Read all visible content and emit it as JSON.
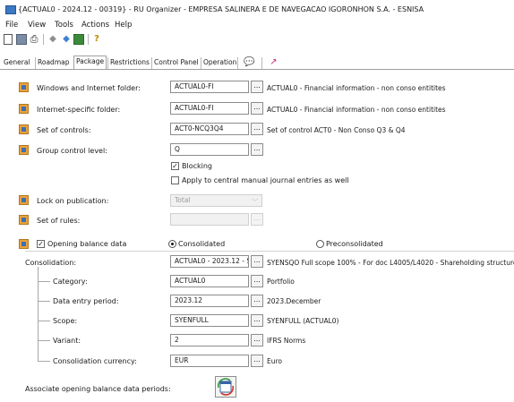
{
  "window": {
    "title": "{ACTUAL0 - 2024.12 - 00319} - RU Organizer - EMPRESA SALINERA E DE NAVEGACAO IGORONHON S.A. - ESNISA"
  },
  "menu": [
    "File",
    "View",
    "Tools",
    "Actions",
    "Help"
  ],
  "toolbar": {
    "icons": [
      "new-document-icon",
      "save-icon",
      "print-icon",
      "back-arrow-icon",
      "forward-arrow-icon",
      "refresh-icon",
      "help-icon"
    ]
  },
  "tabs": [
    "General",
    "Roadmap",
    "Package",
    "Restrictions",
    "Control Panel",
    "Operation"
  ],
  "active_tab": "Package",
  "fields": {
    "windows_folder": {
      "label": "Windows and Internet folder:",
      "value": "ACTUAL0-FI",
      "desc": "ACTUAL0 - Financial information - non conso entitites"
    },
    "internet_folder": {
      "label": "Internet-specific folder:",
      "value": "ACTUAL0-FI",
      "desc": "ACTUAL0 - Financial information - non conso entitites"
    },
    "set_of_controls": {
      "label": "Set of controls:",
      "value": "ACT0-NCQ3Q4",
      "desc": "Set of control ACT0 - Non Conso Q3 & Q4"
    },
    "group_control_level": {
      "label": "Group control level:",
      "value": "Q"
    },
    "blocking": {
      "label": "Blocking",
      "checked": true
    },
    "apply_manual": {
      "label": "Apply to central manual journal entries as well",
      "checked": false
    },
    "lock_on_publication": {
      "label": "Lock on publication:",
      "value": "Total"
    },
    "set_of_rules": {
      "label": "Set of rules:",
      "value": ""
    },
    "opening_balance": {
      "label": "Opening balance data",
      "checked": true
    },
    "radio_consolidated": {
      "label": "Consolidated",
      "selected": true
    },
    "radio_preconsolidated": {
      "label": "Preconsolidated",
      "selected": false
    },
    "consolidation": {
      "label": "Consolidation:",
      "value": "ACTUAL0 - 2023.12 - S",
      "desc": "SYENSQO Full scope 100% - For doc L4005/L4020 - Shareholding structure"
    },
    "category": {
      "label": "Category:",
      "value": "ACTUAL0",
      "desc": "Portfolio"
    },
    "data_entry_period": {
      "label": "Data entry period:",
      "value": "2023.12",
      "desc": "2023.December"
    },
    "scope": {
      "label": "Scope:",
      "value": "SYENFULL",
      "desc": "SYENFULL (ACTUAL0)"
    },
    "variant": {
      "label": "Variant:",
      "value": "2",
      "desc": "IFRS Norms"
    },
    "consolidation_currency": {
      "label": "Consolidation currency:",
      "value": "EUR",
      "desc": "Euro"
    },
    "associate_periods": {
      "label": "Associate opening balance data periods:"
    }
  },
  "ellipsis": "..."
}
